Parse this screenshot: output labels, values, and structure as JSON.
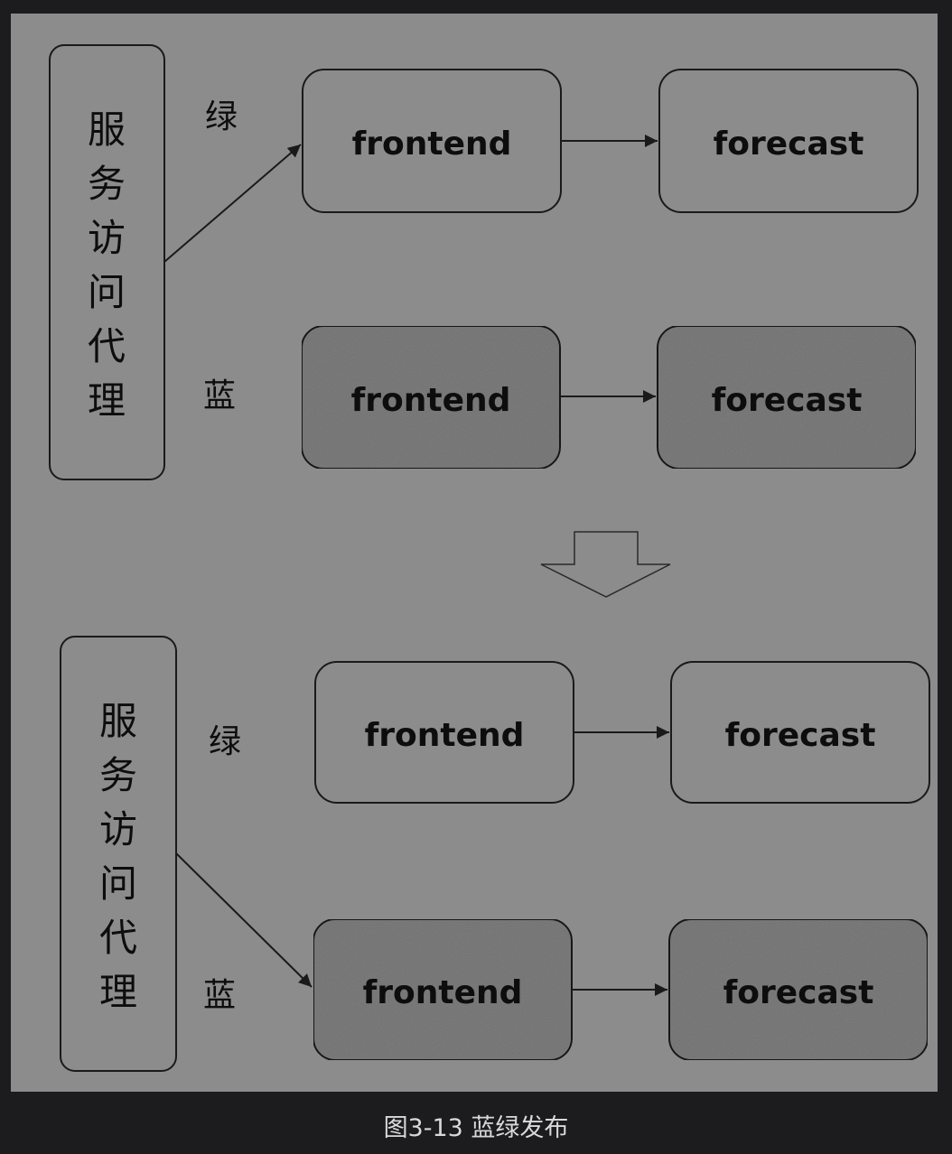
{
  "figure": {
    "top": {
      "proxy_chars": [
        "服",
        "务",
        "访",
        "问",
        "代",
        "理"
      ],
      "green_label": "绿",
      "blue_label": "蓝",
      "green_frontend": "frontend",
      "green_forecast": "forecast",
      "blue_frontend": "frontend",
      "blue_forecast": "forecast",
      "active_route": "green"
    },
    "bottom": {
      "proxy_chars": [
        "服",
        "务",
        "访",
        "问",
        "代",
        "理"
      ],
      "green_label": "绿",
      "blue_label": "蓝",
      "green_frontend": "frontend",
      "green_forecast": "forecast",
      "blue_frontend": "frontend",
      "blue_forecast": "forecast",
      "active_route": "blue"
    },
    "transition_icon": "down-arrow-icon"
  },
  "caption": "图3-13 蓝绿发布",
  "colors": {
    "page_background": "#1c1c1e",
    "diagram_background": "#8c8c8c",
    "green_box_fill": "#8c8c8c",
    "blue_box_fill": "#7e7e7e",
    "stroke": "#1a1a1a",
    "caption_text": "#d9d9d9"
  }
}
